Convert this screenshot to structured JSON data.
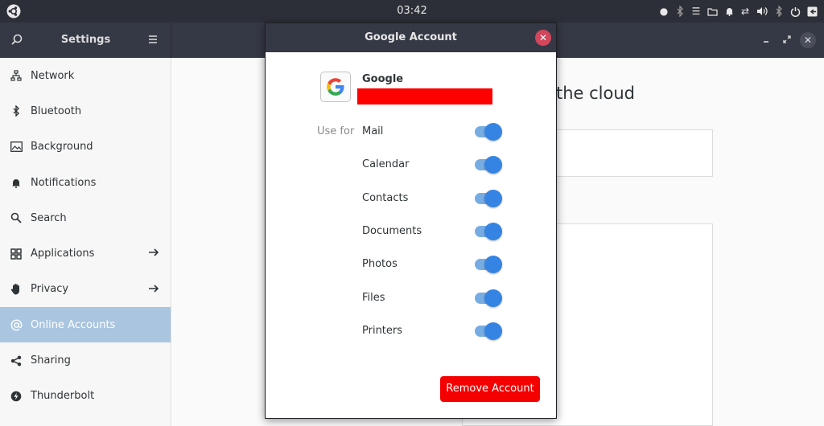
{
  "top_panel": {
    "clock": "03:42",
    "icons": [
      "ubuntu-icon",
      "record-dot-icon",
      "bluetooth-dim-icon",
      "menu-icon",
      "folder-icon",
      "bell-icon",
      "network-icon",
      "volume-icon",
      "bluetooth-icon",
      "power-icon",
      "logout-icon"
    ]
  },
  "settings": {
    "title": "Settings",
    "sidebar": {
      "items": [
        {
          "label": "Network",
          "icon": "network-icon"
        },
        {
          "label": "Bluetooth",
          "icon": "bluetooth-icon"
        },
        {
          "label": "Background",
          "icon": "image-icon"
        },
        {
          "label": "Notifications",
          "icon": "bell-icon"
        },
        {
          "label": "Search",
          "icon": "search-icon"
        },
        {
          "label": "Applications",
          "icon": "grid-icon",
          "arrow": true
        },
        {
          "label": "Privacy",
          "icon": "hand-icon",
          "arrow": true
        },
        {
          "label": "Online Accounts",
          "icon": "at-icon",
          "active": true
        },
        {
          "label": "Sharing",
          "icon": "share-icon"
        },
        {
          "label": "Thunderbolt",
          "icon": "thunderbolt-icon"
        }
      ]
    },
    "content": {
      "heading_fragment": "the cloud"
    }
  },
  "dialog": {
    "title": "Google Account",
    "provider": "Google",
    "use_for_label": "Use for",
    "services": [
      {
        "label": "Mail",
        "enabled": true
      },
      {
        "label": "Calendar",
        "enabled": true
      },
      {
        "label": "Contacts",
        "enabled": true
      },
      {
        "label": "Documents",
        "enabled": true
      },
      {
        "label": "Photos",
        "enabled": true
      },
      {
        "label": "Files",
        "enabled": true
      },
      {
        "label": "Printers",
        "enabled": true
      }
    ],
    "remove_label": "Remove Account"
  },
  "colors": {
    "panel": "#2d2f38",
    "headerbar": "#353945",
    "accent": "#3584e4",
    "active_row": "#a9c5e0",
    "destructive": "#f40000",
    "close": "#d2455b"
  }
}
